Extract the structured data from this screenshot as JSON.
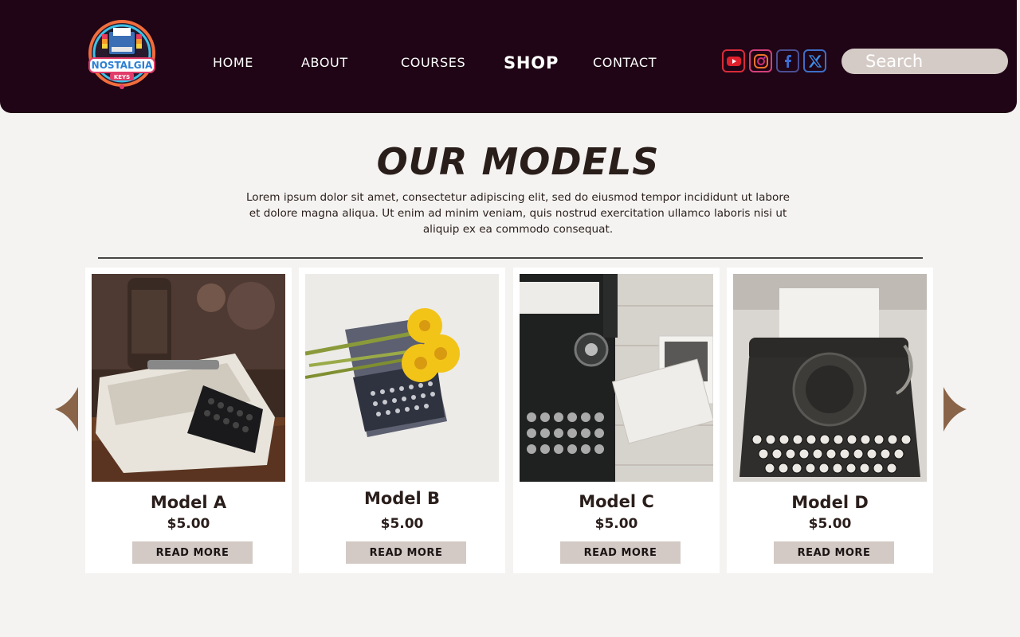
{
  "brand": {
    "logo_line1": "NOSTALGIA",
    "logo_line2": "KEYS"
  },
  "nav": {
    "home": "HOME",
    "about": "ABOUT",
    "courses": "COURSES",
    "shop": "SHOP",
    "contact": "CONTACT"
  },
  "social": [
    "youtube-icon",
    "instagram-icon",
    "facebook-icon",
    "x-icon"
  ],
  "search": {
    "placeholder": "Search"
  },
  "section": {
    "title": "OUR MODELS",
    "description": "Lorem ipsum dolor sit amet, consectetur adipiscing elit, sed do eiusmod tempor incididunt ut labore et dolore magna aliqua. Ut enim ad minim veniam, quis nostrud exercitation ullamco laboris nisi ut aliquip ex ea commodo consequat."
  },
  "products": [
    {
      "name": "Model A",
      "price": "$5.00",
      "button": "READ MORE"
    },
    {
      "name": "Model B",
      "price": "$5.00",
      "button": "READ MORE"
    },
    {
      "name": "Model C",
      "price": "$5.00",
      "button": "READ MORE"
    },
    {
      "name": "Model D",
      "price": "$5.00",
      "button": "READ MORE"
    }
  ],
  "colors": {
    "header_bg": "#1f0515",
    "page_bg": "#f4f3f1",
    "accent_brown": "#8a6448",
    "button_bg": "#d3cac5",
    "text_dark": "#2a1e1b"
  }
}
